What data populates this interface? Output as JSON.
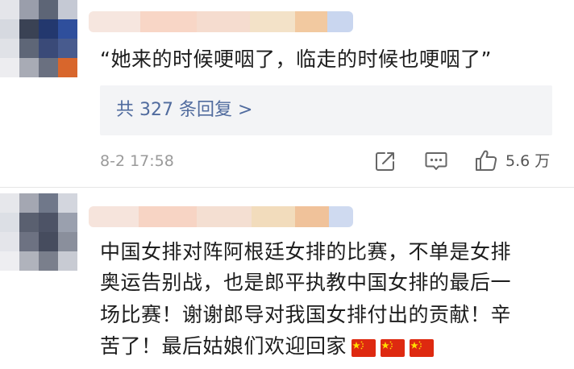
{
  "comments": [
    {
      "text_lines": [
        "“她来的时候哽咽了，临走的时候也哽咽了”"
      ],
      "replies_label": "共 327 条回复 >",
      "timestamp": "8-2 17:58",
      "like_count": "5.6 万"
    },
    {
      "text_lines": [
        "中国女排对阵阿根廷女排的比赛，不单是女排",
        "奥运告别战，也是郎平执教中国女排的最后一",
        "场比赛！谢谢郎导对我国女排付出的贡献！辛",
        "苦了！最后姑娘们欢迎回家"
      ],
      "emoji_flags": [
        "china-flag",
        "china-flag",
        "china-flag"
      ]
    }
  ],
  "icons": [
    "share-icon",
    "comment-icon",
    "like-icon"
  ],
  "colors": {
    "link": "#506b9e",
    "timestamp": "#9a9a9a",
    "replies_background": "#f3f4f6",
    "flag_red": "#de2910",
    "flag_star": "#ffde00"
  }
}
